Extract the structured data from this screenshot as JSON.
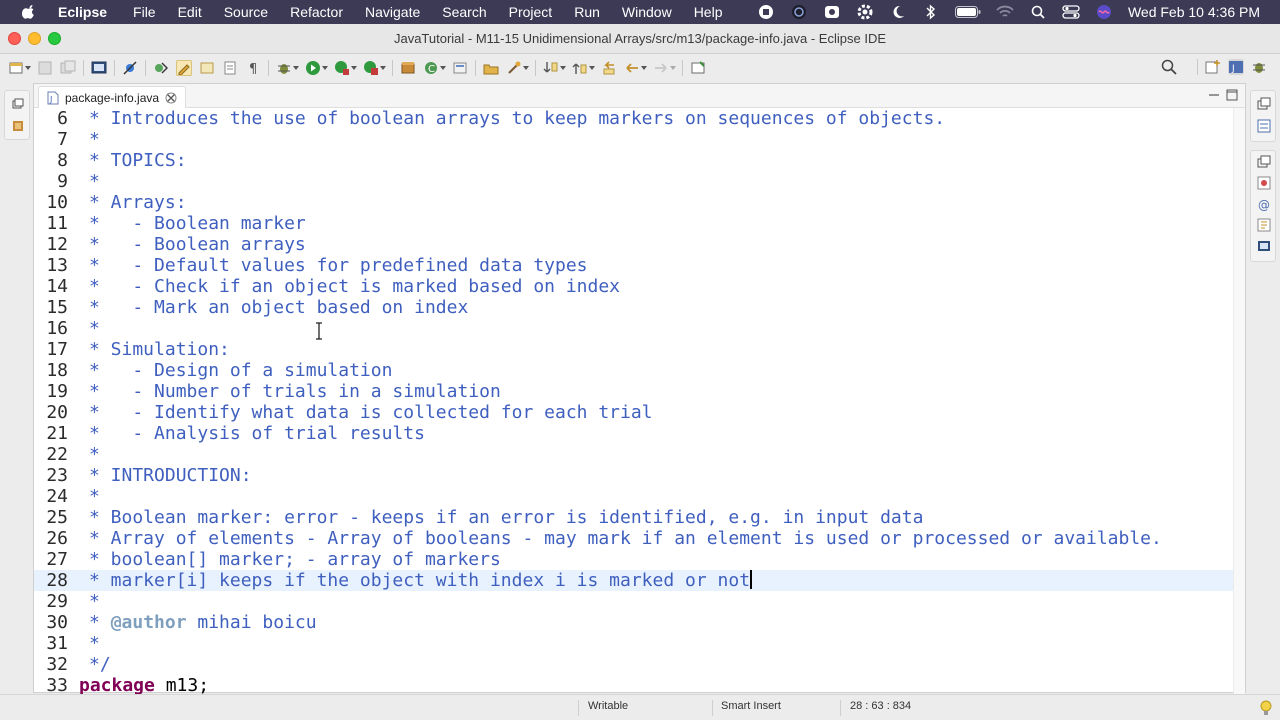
{
  "menubar": {
    "app": "Eclipse",
    "items": [
      "File",
      "Edit",
      "Source",
      "Refactor",
      "Navigate",
      "Search",
      "Project",
      "Run",
      "Window",
      "Help"
    ],
    "clock": "Wed Feb 10  4:36 PM"
  },
  "window": {
    "title": "JavaTutorial - M11-15 Unidimensional Arrays/src/m13/package-info.java - Eclipse IDE"
  },
  "editor": {
    "tab_label": "package-info.java",
    "lines": [
      {
        "n": "6",
        "text": "* Introduces the use of boolean arrays to keep markers on sequences of objects."
      },
      {
        "n": "7",
        "text": "*"
      },
      {
        "n": "8",
        "text": "* TOPICS:"
      },
      {
        "n": "9",
        "text": "*"
      },
      {
        "n": "10",
        "text": "* Arrays:"
      },
      {
        "n": "11",
        "text": "*   - Boolean marker"
      },
      {
        "n": "12",
        "text": "*   - Boolean arrays"
      },
      {
        "n": "13",
        "text": "*   - Default values for predefined data types"
      },
      {
        "n": "14",
        "text": "*   - Check if an object is marked based on index"
      },
      {
        "n": "15",
        "text": "*   - Mark an object based on index"
      },
      {
        "n": "16",
        "text": "*"
      },
      {
        "n": "17",
        "text": "* Simulation:"
      },
      {
        "n": "18",
        "text": "*   - Design of a simulation"
      },
      {
        "n": "19",
        "text": "*   - Number of trials in a simulation"
      },
      {
        "n": "20",
        "text": "*   - Identify what data is collected for each trial"
      },
      {
        "n": "21",
        "text": "*   - Analysis of trial results"
      },
      {
        "n": "22",
        "text": "*"
      },
      {
        "n": "23",
        "text": "* INTRODUCTION:"
      },
      {
        "n": "24",
        "text": "*"
      },
      {
        "n": "25",
        "text": "* Boolean marker: error - keeps if an error is identified, e.g. in input data"
      },
      {
        "n": "26",
        "text": "* Array of elements - Array of booleans - may mark if an element is used or processed or available."
      },
      {
        "n": "27",
        "text": "* boolean[] marker; - array of markers"
      },
      {
        "n": "28",
        "text": "* marker[i] keeps if the object with index i is marked or not"
      },
      {
        "n": "29",
        "text": "*"
      },
      {
        "n": "30",
        "prefix": "* ",
        "tag": "@author",
        "text": " mihai boicu"
      },
      {
        "n": "31",
        "text": "*"
      },
      {
        "n": "32",
        "text": "*/"
      },
      {
        "n": "33",
        "keyword": "package",
        "text": " m13;"
      }
    ]
  },
  "statusbar": {
    "mode": "Writable",
    "insert": "Smart Insert",
    "position": "28 : 63 : 834"
  },
  "colors": {
    "javadoc": "#3f5fbf",
    "javadoc_tag": "#7f9fbf",
    "keyword": "#7f0055",
    "current_line": "#e8f2fe",
    "menubar_bg": "#3c3a55"
  }
}
